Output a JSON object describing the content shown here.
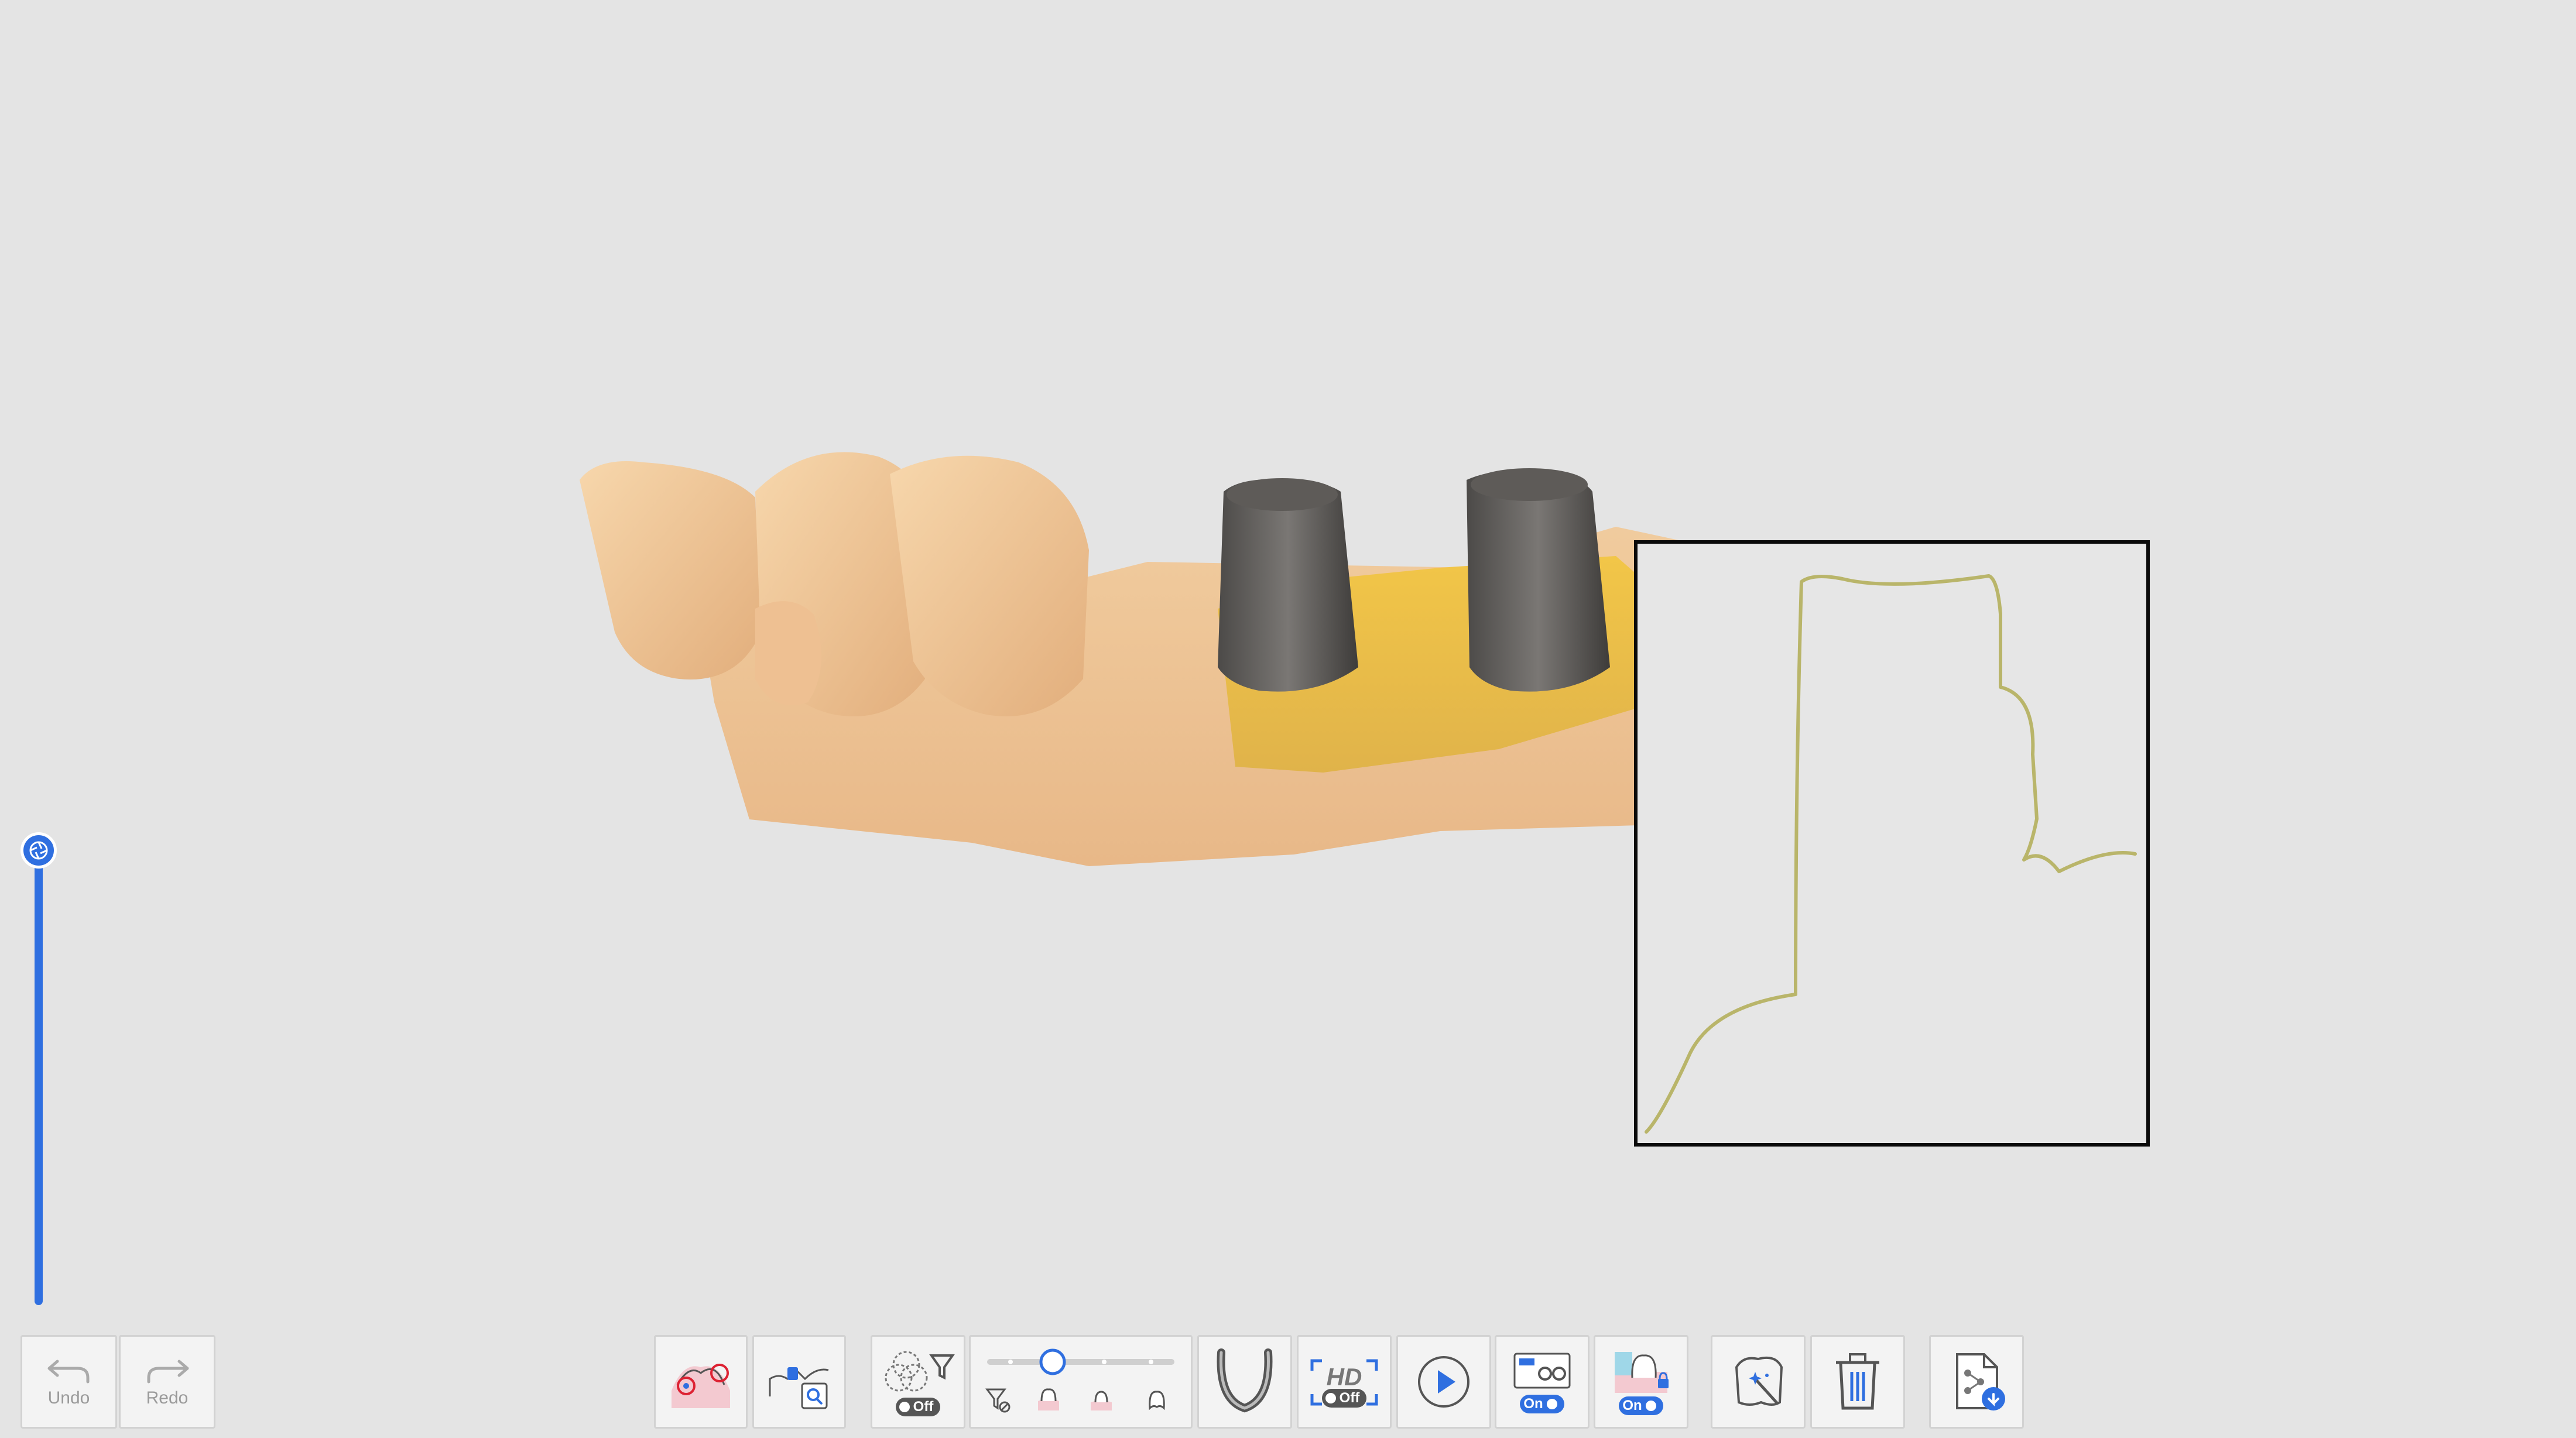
{
  "history": {
    "undo_label": "Undo",
    "redo_label": "Redo"
  },
  "toolbar": {
    "filter_toggle_state": "Off",
    "hd_label": "HD",
    "hd_toggle_state": "Off",
    "overlay_toggle_state": "On",
    "lock_toggle_state": "On",
    "filter_level": 0.35
  },
  "colors": {
    "accent": "#2f6fe0",
    "section_curve": "#b9b56a",
    "background": "#e4e4e4"
  },
  "icons": [
    "margin-line-icon",
    "scan-inspect-icon",
    "filter-icon",
    "arch-icon",
    "play-icon",
    "overlay-view-icon",
    "lock-tooth-icon",
    "magic-tooth-icon",
    "trash-icon",
    "export-file-icon",
    "undo-icon",
    "redo-icon",
    "aperture-icon"
  ]
}
